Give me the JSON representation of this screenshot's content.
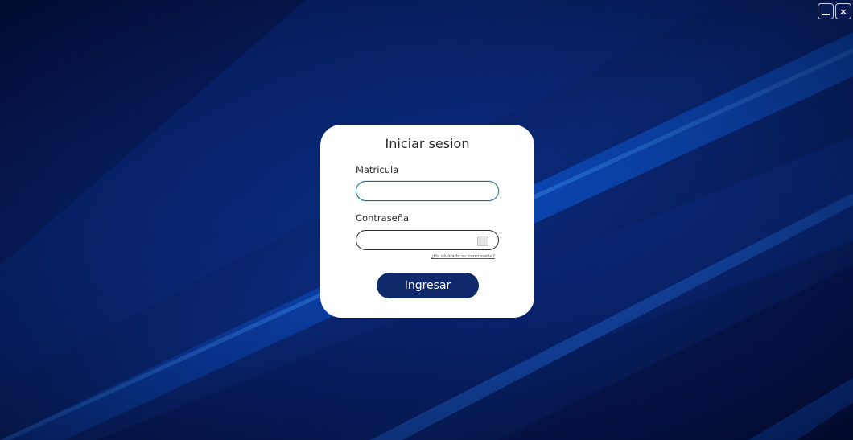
{
  "window": {
    "minimize_label": "",
    "close_label": "×"
  },
  "login": {
    "title": "Iniciar sesion",
    "matricula_label": "Matricula",
    "matricula_value": "",
    "password_label": "Contraseña",
    "password_value": "",
    "forgot_link": "¿Ha olvidado su contraseña?",
    "submit_label": "Ingresar"
  },
  "colors": {
    "background": "#06103a",
    "accent": "#0f2a6b",
    "card": "#ffffff"
  },
  "icons": {
    "minimize": "minimize-icon",
    "close": "close-icon",
    "password_toggle": "eye-toggle-icon"
  }
}
